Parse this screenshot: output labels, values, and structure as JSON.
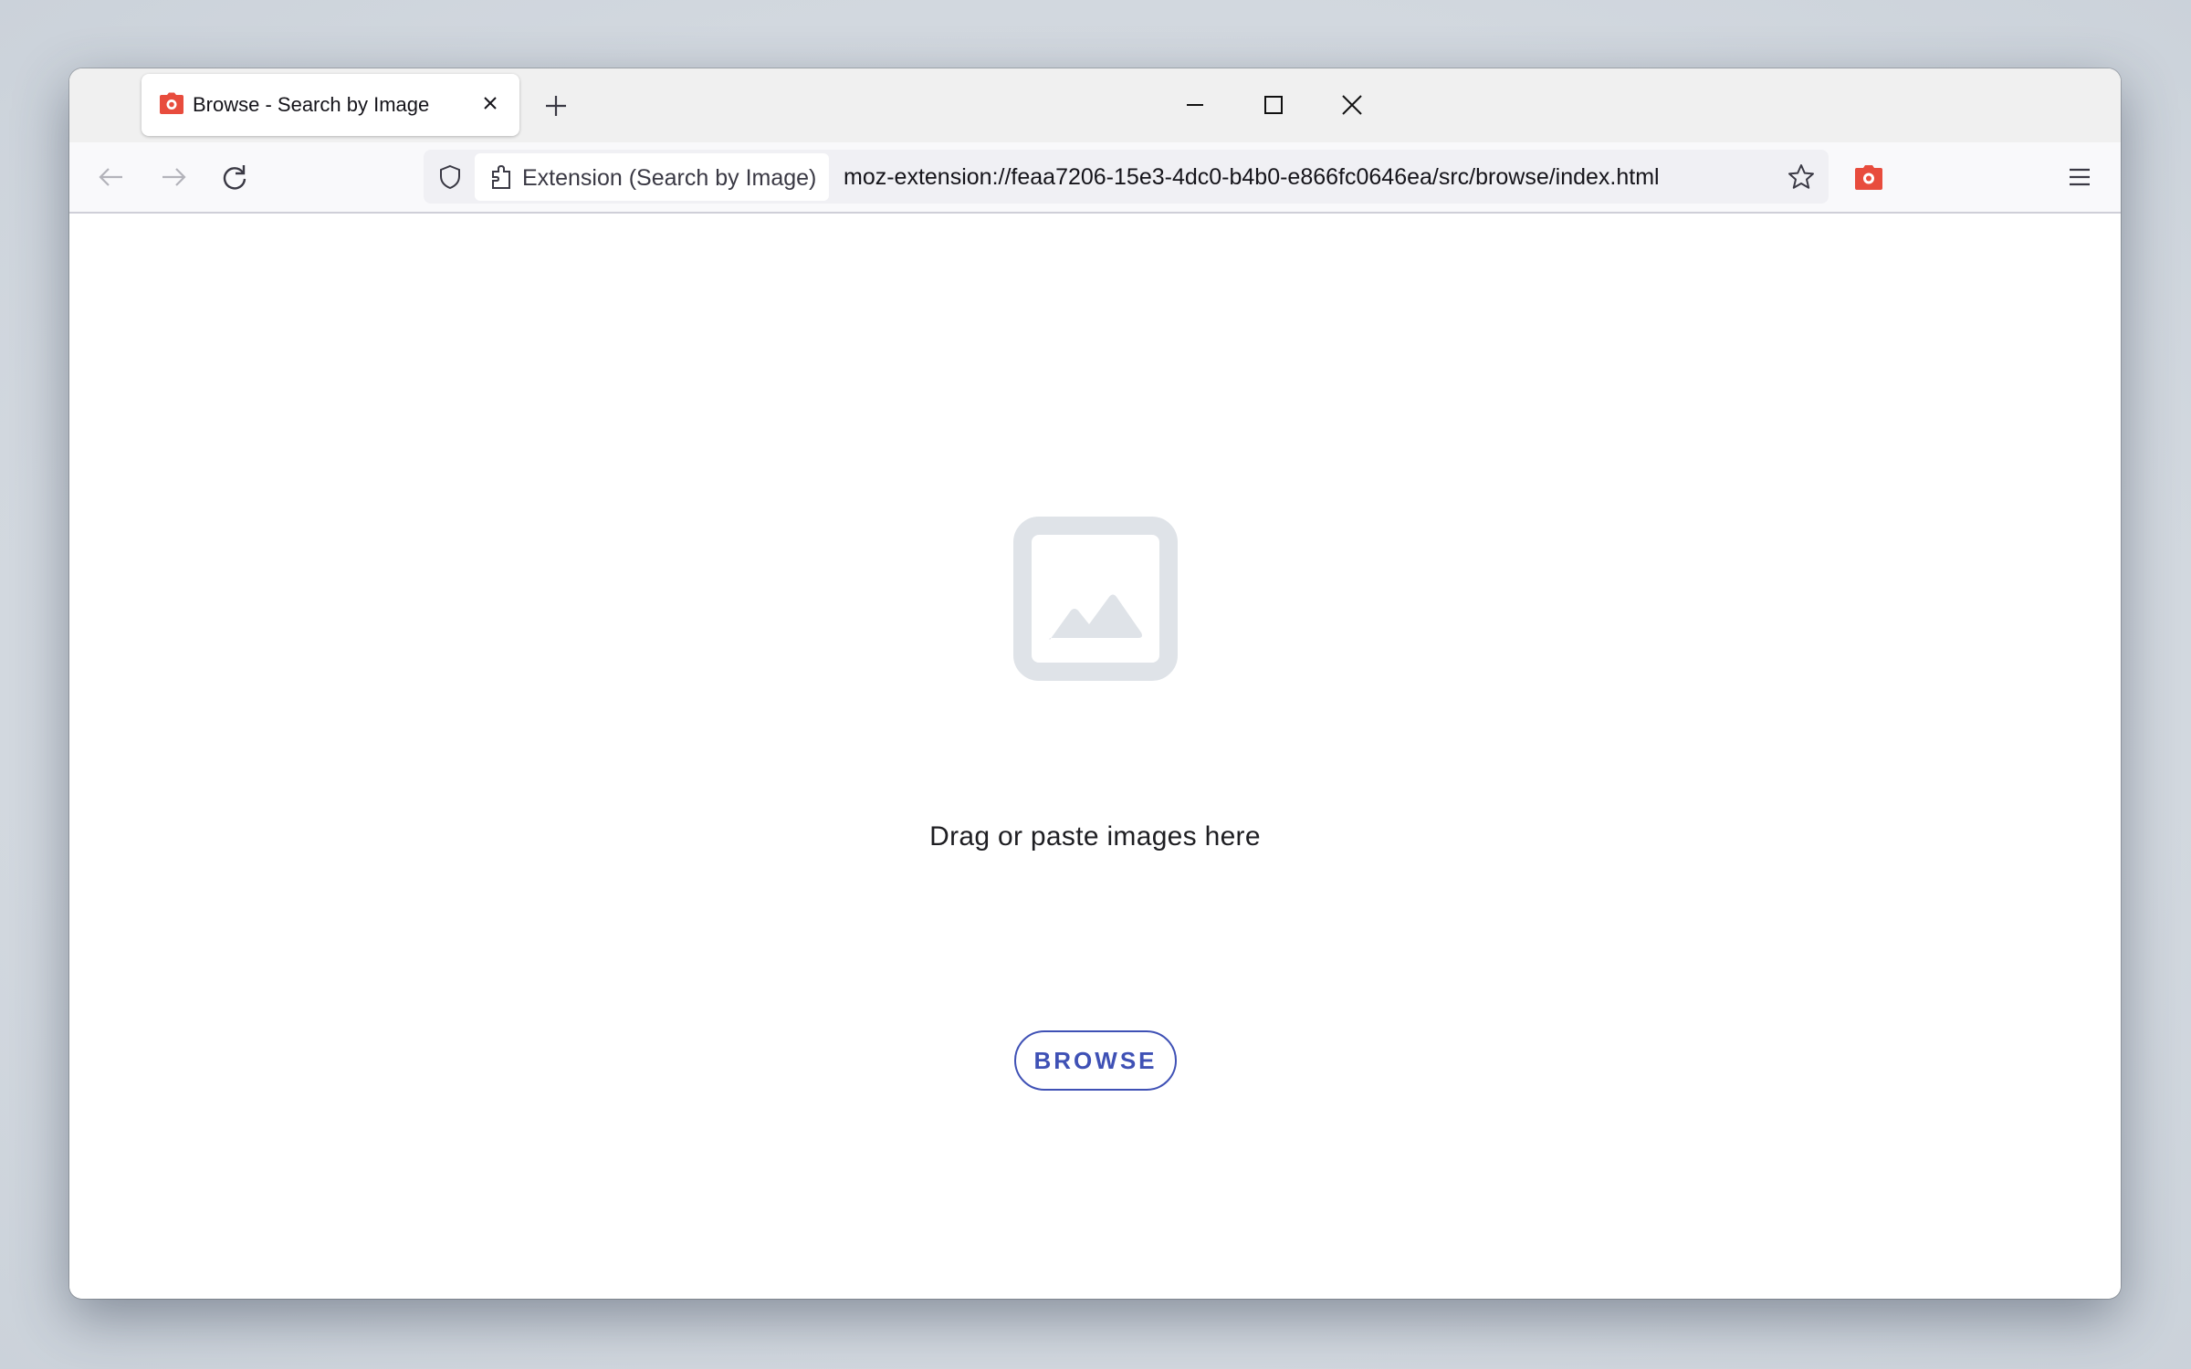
{
  "browser": {
    "tab": {
      "title": "Browse - Search by Image",
      "favicon": "camera-icon",
      "favicon_color": "#e84c3d"
    },
    "window_controls": [
      "minimize-icon",
      "maximize-icon",
      "close-icon"
    ],
    "toolbar": {
      "identity_label": "Extension (Search by Image)",
      "url": "moz-extension://feaa7206-15e3-4dc0-b4b0-e866fc0646ea/src/browse/index.html",
      "icons": [
        "back-arrow-icon",
        "forward-arrow-icon",
        "reload-icon",
        "shield-icon",
        "puzzle-icon",
        "star-icon",
        "camera-icon",
        "hamburger-menu-icon"
      ]
    }
  },
  "page": {
    "placeholder_icon": "image-placeholder-icon",
    "drop_text": "Drag or paste images here",
    "browse_button": "BROWSE",
    "accent_color": "#3f51b5",
    "placeholder_color": "#dfe3e8"
  }
}
